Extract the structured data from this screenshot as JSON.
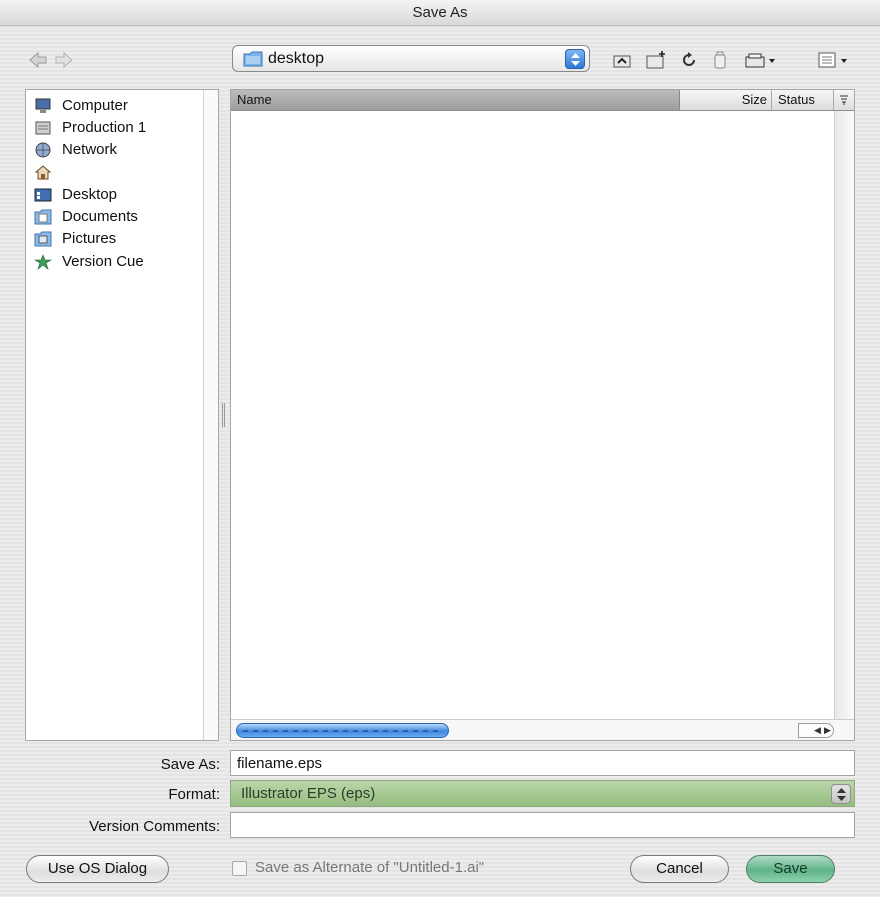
{
  "window": {
    "title": "Save As"
  },
  "path": {
    "current": "desktop"
  },
  "sidebar": {
    "items": [
      {
        "label": "Computer",
        "icon": "computer-icon"
      },
      {
        "label": "Production 1",
        "icon": "hard-drive-icon"
      },
      {
        "label": "Network",
        "icon": "network-icon"
      },
      {
        "label": "",
        "icon": "home-icon"
      },
      {
        "label": "Desktop",
        "icon": "desktop-icon"
      },
      {
        "label": "Documents",
        "icon": "documents-folder-icon"
      },
      {
        "label": "Pictures",
        "icon": "pictures-folder-icon"
      },
      {
        "label": "Version Cue",
        "icon": "version-cue-icon"
      }
    ]
  },
  "browser": {
    "columns": {
      "name": "Name",
      "size": "Size",
      "status": "Status"
    }
  },
  "form": {
    "save_as_label": "Save As:",
    "save_as_value": "filename.eps",
    "format_label": "Format:",
    "format_value": "Illustrator EPS (eps)",
    "version_comments_label": "Version Comments:",
    "version_comments_value": ""
  },
  "footer": {
    "use_os_dialog": "Use OS Dialog",
    "alternate_label": "Save as Alternate of \"Untitled-1.ai\"",
    "cancel": "Cancel",
    "save": "Save"
  },
  "colors": {
    "format_popup": "#a8cc96",
    "save_button": "#6fbf95",
    "scroll_thumb": "#3f88e0"
  }
}
